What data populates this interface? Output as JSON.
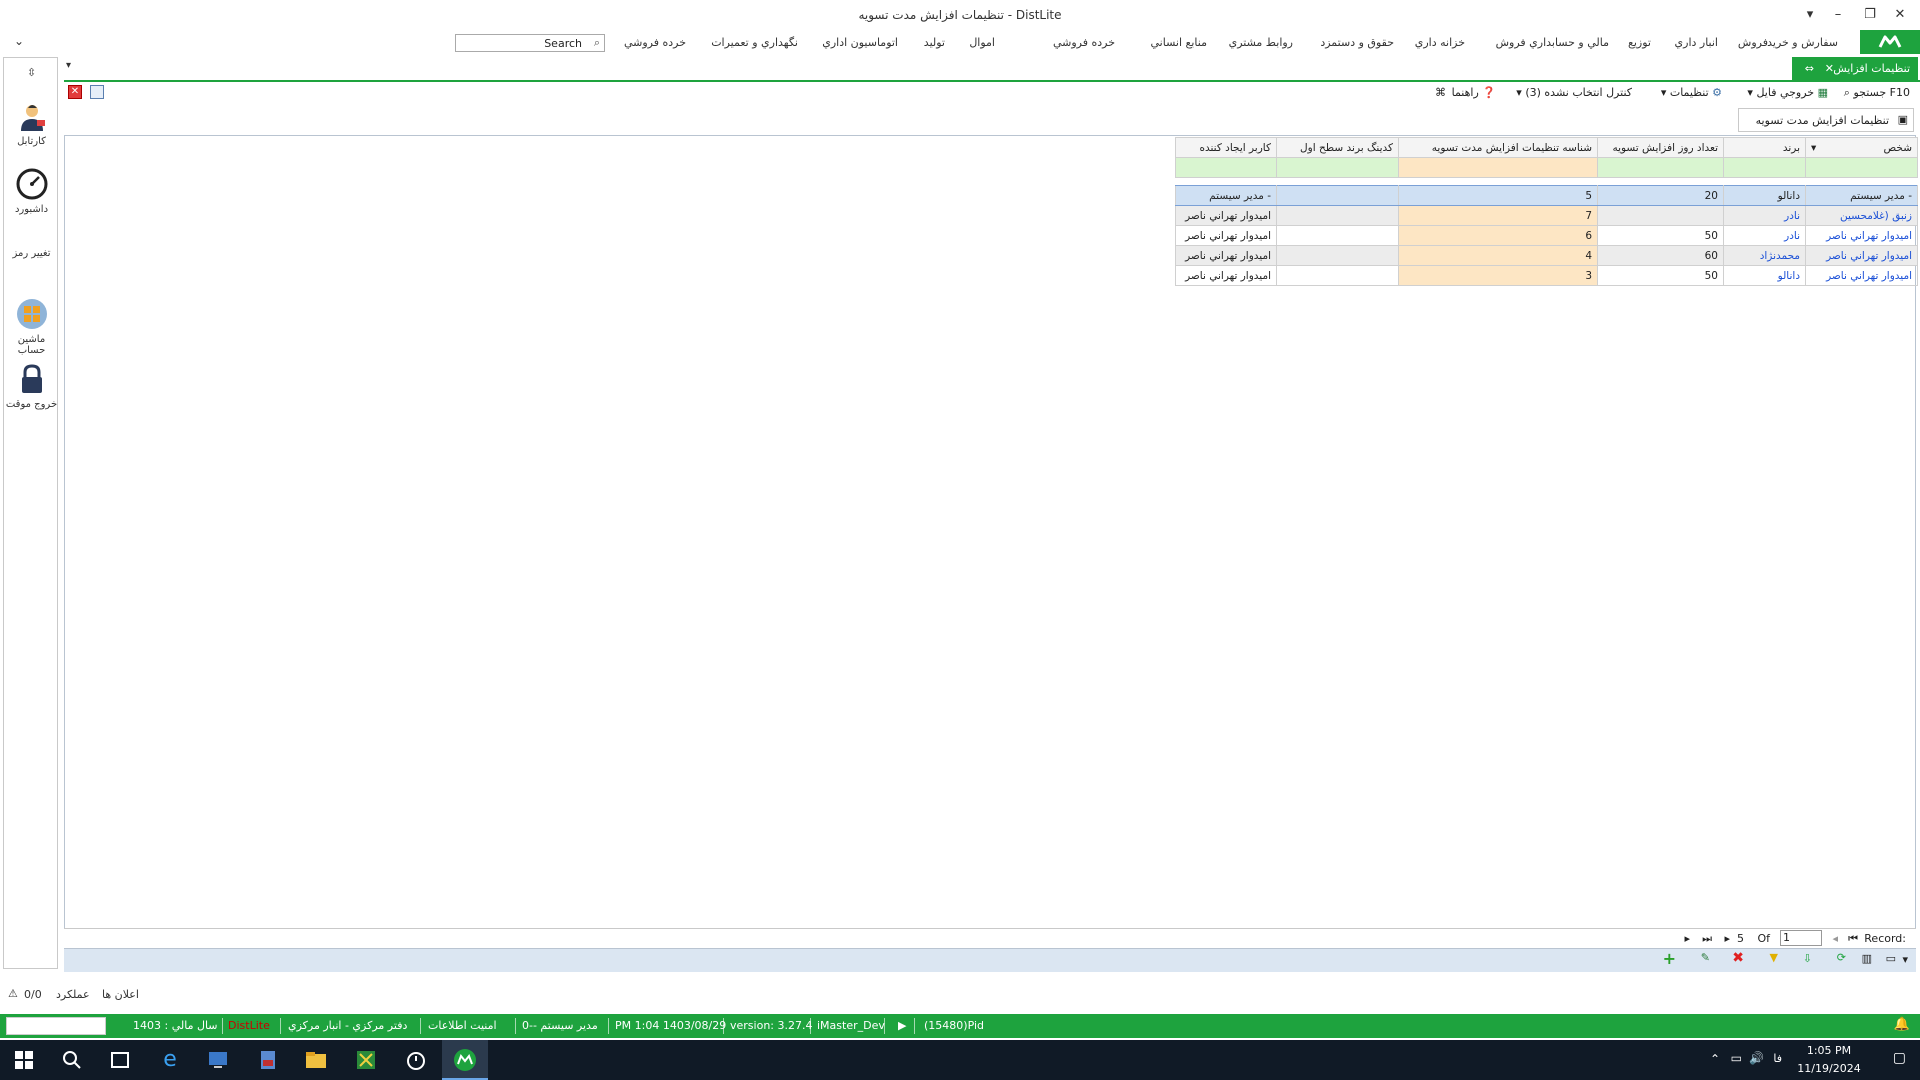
{
  "window": {
    "title": "تنظیمات افزایش مدت تسویه - DistLite",
    "btn_pin": "▾",
    "btn_min": "–",
    "btn_restore": "❐",
    "btn_close": "✕"
  },
  "menu": {
    "items": [
      "سفارش و خرید",
      "فروش",
      "انبار داري",
      "توزيع",
      "مالي و حسابداري فروش",
      "خزانه داري",
      "حقوق و دستمزد",
      "روابط مشتري",
      "منابع انساني",
      "خرده فروشي",
      "اموال",
      "توليد",
      "اتوماسيون اداري",
      "نگهداري و تعميرات",
      "خرده فروشي"
    ],
    "search_label": "Search"
  },
  "tab": {
    "label": "تنظیمات افزایش",
    "close": "✕",
    "pin": "⇔"
  },
  "toolbar": {
    "search_f10": "جستجو F10",
    "export": "خروجي فايل",
    "settings": "تنظيمات",
    "selection_control": "کنترل انتخاب نشده (3)",
    "help": "راهنما"
  },
  "subtab": {
    "label": "تنظيمات افزايش مدت تسويه"
  },
  "leftrail": {
    "pin": "⇳",
    "items": [
      {
        "label": "کارتابل"
      },
      {
        "label": "داشبورد"
      },
      {
        "label": "تغيير رمز"
      },
      {
        "label": "ماشين حساب"
      },
      {
        "label": "خروج موقت"
      }
    ]
  },
  "grid": {
    "columns": [
      "شخص",
      "برند",
      "تعداد روز افزايش تسويه",
      "شناسه تنظيمات افزايش مدت تسويه",
      "کدينگ برند سطح اول",
      "کاربر ايجاد کننده"
    ],
    "rows": [
      {
        "person": "مدير سيستم -",
        "brand": "دانالو",
        "days": "20",
        "id": "5",
        "brand_code": "",
        "creator": "مدير سيستم -",
        "selected": true
      },
      {
        "person": "زنبق (غلامحسين",
        "brand": "نادر",
        "days": "",
        "id": "7",
        "brand_code": "",
        "creator": "اميدوار تهراني ناصر"
      },
      {
        "person": "اميدوار تهراني ناصر",
        "brand": "نادر",
        "days": "50",
        "id": "6",
        "brand_code": "",
        "creator": "اميدوار تهراني ناصر"
      },
      {
        "person": "اميدوار تهراني ناصر",
        "brand": "محمدنژاد",
        "days": "60",
        "id": "4",
        "brand_code": "",
        "creator": "اميدوار تهراني ناصر"
      },
      {
        "person": "اميدوار تهراني ناصر",
        "brand": "دانالو",
        "days": "50",
        "id": "3",
        "brand_code": "",
        "creator": "اميدوار تهراني ناصر"
      }
    ]
  },
  "recnav": {
    "record_label": "Record:",
    "current": "1",
    "of_label": "Of",
    "total": "5"
  },
  "alerts": {
    "announcements": "اعلان ها",
    "performance": "عملکرد",
    "count": "0/0"
  },
  "status": {
    "pid": "(15480)Pid",
    "user_db": "iMaster_Dev",
    "version": "version: 3.27.4",
    "datetime": "PM 1:04 1403/08/29",
    "user": "مدير سيستم --0",
    "security": "امنيت اطلاعات",
    "branch": "دفتر مرکزي - انبار مرکزي",
    "app": "DistLite",
    "fiscal_year": "سال مالي : 1403"
  },
  "taskbar": {
    "time": "1:05 PM",
    "date": "11/19/2024",
    "lang": "فا"
  },
  "colors": {
    "accent": "#1ea33e",
    "link": "#1a4fd6",
    "filter_green": "#d9f5d0",
    "filter_orange": "#fde6c4"
  }
}
